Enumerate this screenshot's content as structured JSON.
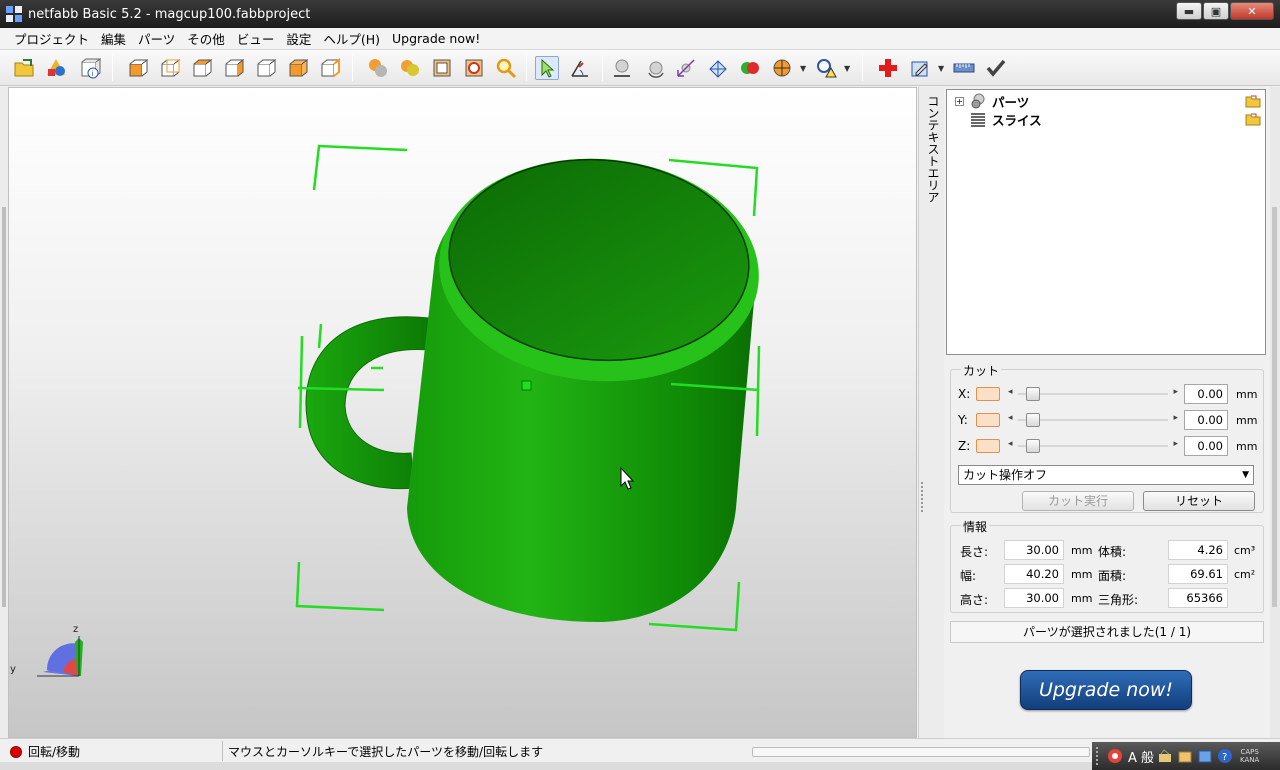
{
  "window": {
    "title": "netfabb Basic 5.2 - magcup100.fabbproject",
    "minimize": "▬",
    "maximize": "▣",
    "close": "✕"
  },
  "menu": [
    "プロジェクト",
    "編集",
    "パーツ",
    "その他",
    "ビュー",
    "設定",
    "ヘルプ(H)",
    "Upgrade now!"
  ],
  "viewport": {
    "model": "mug",
    "model_color": "#1fae12",
    "bracket_color": "#22dd22",
    "axis_labels": {
      "z": "z",
      "y": "y"
    }
  },
  "context_tab": {
    "label": "コンテキストエリア"
  },
  "tree": {
    "items": [
      {
        "label": "パーツ",
        "expander": "+"
      },
      {
        "label": "スライス"
      }
    ]
  },
  "cut": {
    "title": "カット",
    "rows": [
      {
        "axis": "X:",
        "value": "0.00",
        "unit": "mm"
      },
      {
        "axis": "Y:",
        "value": "0.00",
        "unit": "mm"
      },
      {
        "axis": "Z:",
        "value": "0.00",
        "unit": "mm"
      }
    ],
    "slider_left": "◂",
    "slider_right": "▸",
    "mode_select": "カット操作オフ",
    "execute_button": "カット実行",
    "reset_button": "リセット"
  },
  "info": {
    "title": "情報",
    "length_label": "長さ:",
    "length_value": "30.00",
    "length_unit": "mm",
    "width_label": "幅:",
    "width_value": "40.20",
    "width_unit": "mm",
    "height_label": "高さ:",
    "height_value": "30.00",
    "height_unit": "mm",
    "volume_label": "体積:",
    "volume_value": "4.26",
    "volume_unit": "cm³",
    "area_label": "面積:",
    "area_value": "69.61",
    "area_unit": "cm²",
    "triangles_label": "三角形:",
    "triangles_value": "65366"
  },
  "selection_status": "パーツが選択されました(1 / 1)",
  "upgrade_button": "Upgrade now!",
  "statusbar": {
    "mode": "回転/移動",
    "hint": "マウスとカーソルキーで選択したパーツを移動/回転します"
  },
  "ime": {
    "mode_label": "A 般",
    "caps": "CAPS",
    "kana": "KANA"
  }
}
